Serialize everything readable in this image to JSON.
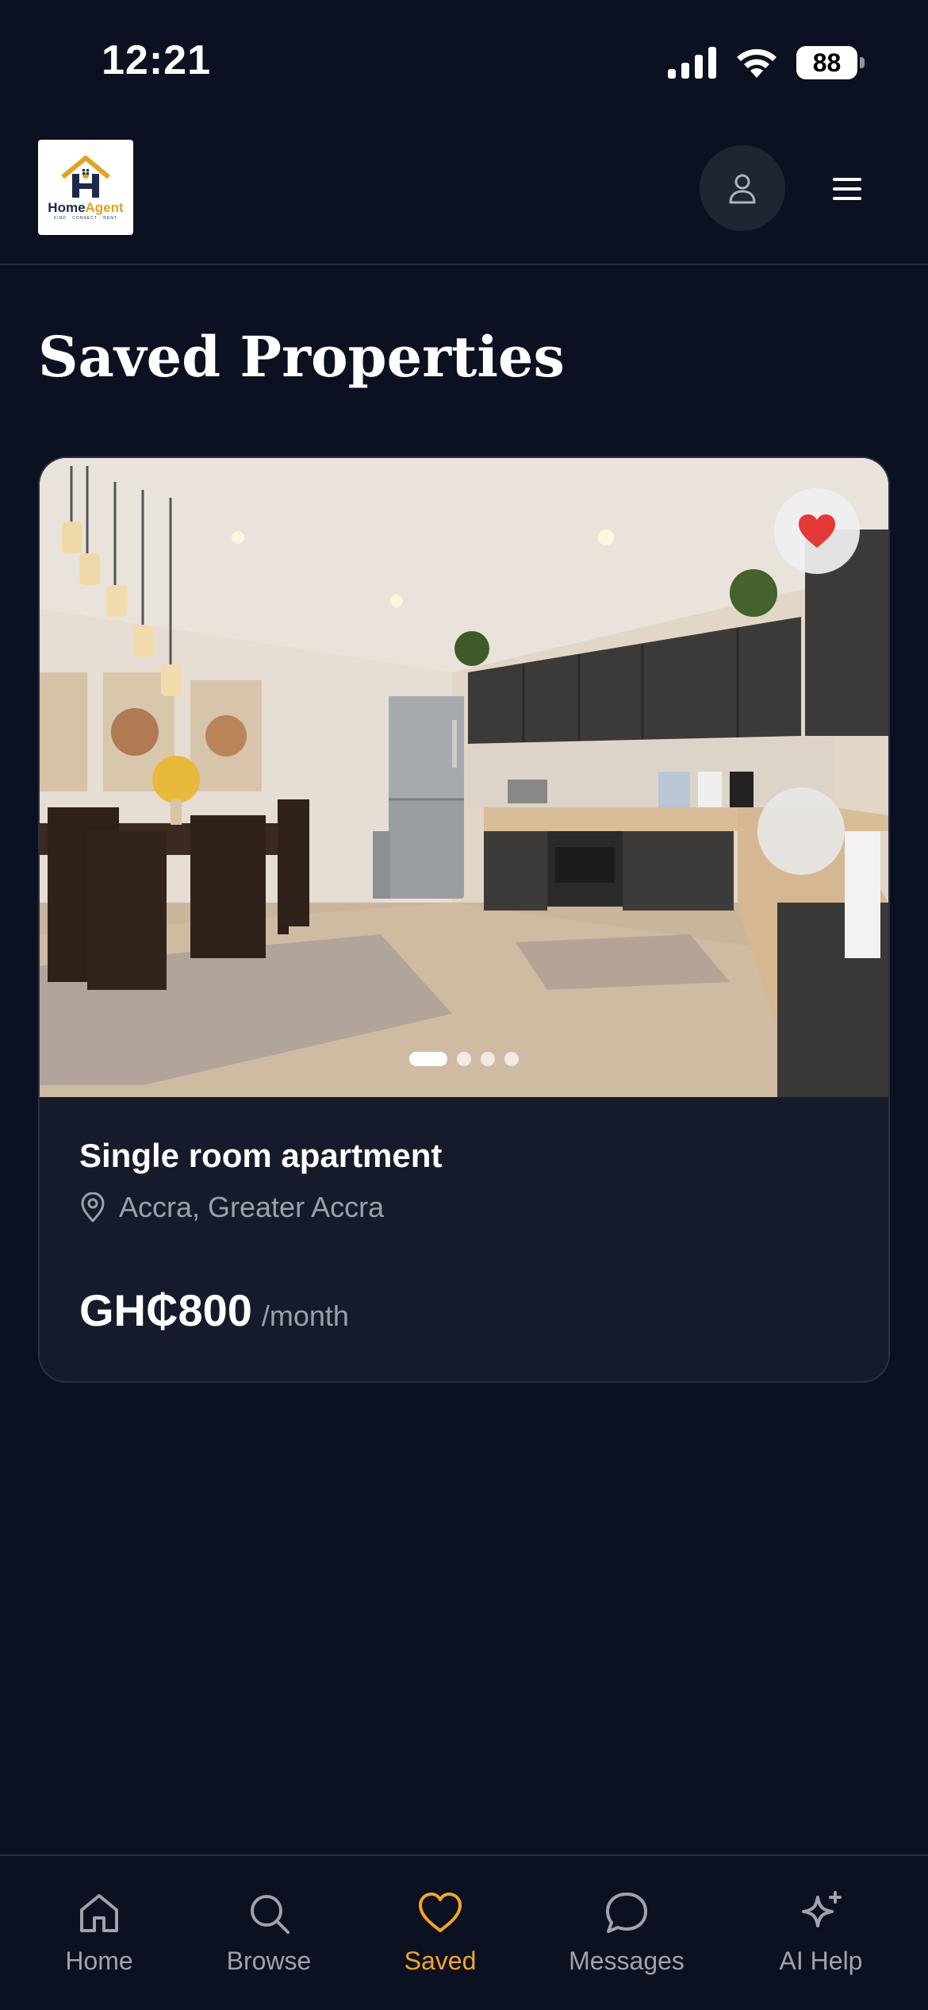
{
  "status_bar": {
    "time": "12:21",
    "battery": "88"
  },
  "header": {
    "logo": {
      "name_part1": "Home",
      "name_part2": "Agent",
      "tagline": "FIND · CONNECT · RENT"
    },
    "profile_icon": "user-icon",
    "menu_icon": "hamburger-menu-icon"
  },
  "page": {
    "title": "Saved Properties"
  },
  "saved_properties": [
    {
      "title": "Single room apartment",
      "location": "Accra, Greater Accra",
      "price": "GH₵800",
      "price_unit": "/month",
      "favorited": true,
      "image_count": 4,
      "active_image_index": 0
    }
  ],
  "bottom_nav": {
    "items": [
      {
        "label": "Home",
        "icon": "home-icon",
        "active": false
      },
      {
        "label": "Browse",
        "icon": "search-icon",
        "active": false
      },
      {
        "label": "Saved",
        "icon": "heart-icon",
        "active": true
      },
      {
        "label": "Messages",
        "icon": "chat-bubble-icon",
        "active": false
      },
      {
        "label": "AI Help",
        "icon": "sparkle-icon",
        "active": false
      }
    ]
  },
  "colors": {
    "background": "#0b1120",
    "card": "#161b2b",
    "accent": "#f5a524",
    "favorite": "#e53935",
    "muted_text": "#9aa1ad"
  }
}
